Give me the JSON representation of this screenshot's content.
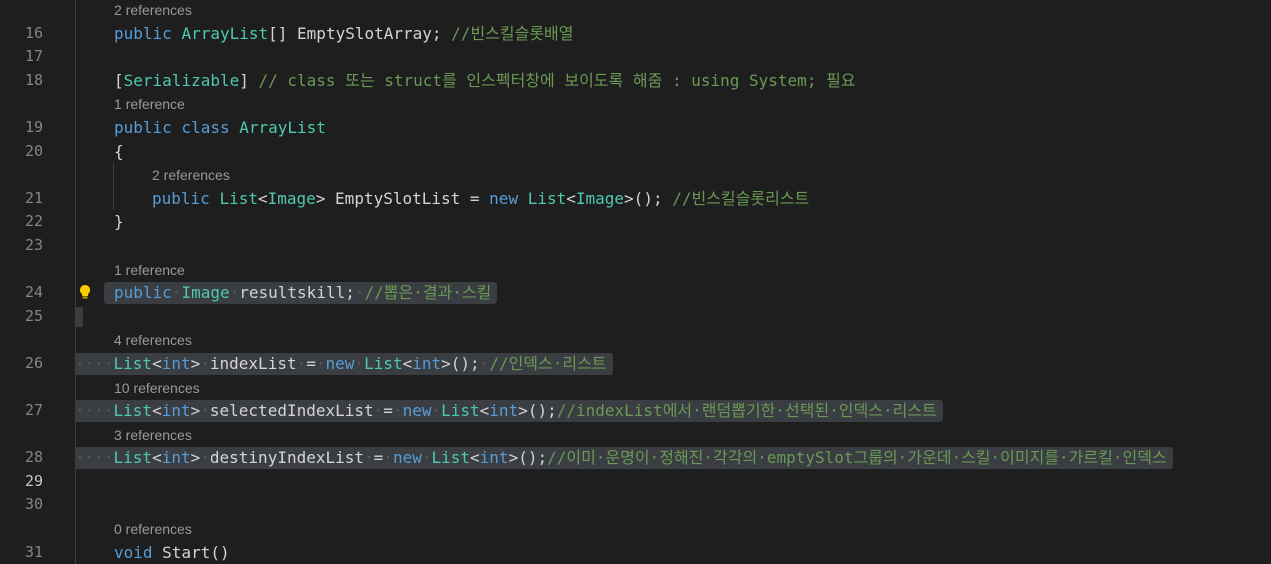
{
  "editor": {
    "lines": [
      {
        "kind": "lens",
        "text": "2 references"
      },
      {
        "kind": "code",
        "num": "16",
        "tokens": [
          {
            "c": "kw",
            "t": "public "
          },
          {
            "c": "ty",
            "t": "ArrayList"
          },
          {
            "c": "pl",
            "t": "[] EmptySlotArray; "
          },
          {
            "c": "cm",
            "t": "//빈스킬슬롯배열"
          }
        ]
      },
      {
        "kind": "code",
        "num": "17",
        "tokens": []
      },
      {
        "kind": "code",
        "num": "18",
        "tokens": [
          {
            "c": "pl",
            "t": "["
          },
          {
            "c": "ty",
            "t": "Serializable"
          },
          {
            "c": "pl",
            "t": "] "
          },
          {
            "c": "cm",
            "t": "// class 또는 struct를 인스펙터창에 보이도록 해줌 : using System; 필요"
          }
        ]
      },
      {
        "kind": "lens",
        "text": "1 reference"
      },
      {
        "kind": "code",
        "num": "19",
        "tokens": [
          {
            "c": "kw",
            "t": "public class "
          },
          {
            "c": "ty",
            "t": "ArrayList"
          }
        ]
      },
      {
        "kind": "code",
        "num": "20",
        "tokens": [
          {
            "c": "pl",
            "t": "{"
          }
        ]
      },
      {
        "kind": "lens",
        "text": "2 references",
        "indent": 2
      },
      {
        "kind": "code",
        "num": "21",
        "indent": 2,
        "tokens": [
          {
            "c": "kw",
            "t": "public "
          },
          {
            "c": "ty",
            "t": "List"
          },
          {
            "c": "pl",
            "t": "<"
          },
          {
            "c": "ty",
            "t": "Image"
          },
          {
            "c": "pl",
            "t": "> EmptySlotList = "
          },
          {
            "c": "kw",
            "t": "new "
          },
          {
            "c": "ty",
            "t": "List"
          },
          {
            "c": "pl",
            "t": "<"
          },
          {
            "c": "ty",
            "t": "Image"
          },
          {
            "c": "pl",
            "t": ">(); "
          },
          {
            "c": "cm",
            "t": "//빈스킬슬롯리스트"
          }
        ]
      },
      {
        "kind": "code",
        "num": "22",
        "tokens": [
          {
            "c": "pl",
            "t": "}"
          }
        ]
      },
      {
        "kind": "code",
        "num": "23",
        "tokens": []
      },
      {
        "kind": "lens",
        "text": "1 reference"
      },
      {
        "kind": "code",
        "num": "24",
        "selected": true,
        "bulb": true,
        "tokens": [
          {
            "c": "kw",
            "t": "public"
          },
          {
            "c": "ws",
            "t": "·"
          },
          {
            "c": "ty",
            "t": "Image"
          },
          {
            "c": "ws",
            "t": "·"
          },
          {
            "c": "pl",
            "t": "resultskill;"
          },
          {
            "c": "ws",
            "t": "·"
          },
          {
            "c": "cm",
            "t": "//뽑은·결과·스킬"
          }
        ]
      },
      {
        "kind": "code",
        "num": "25",
        "caret": true,
        "tokens": []
      },
      {
        "kind": "lens",
        "text": "4 references"
      },
      {
        "kind": "code",
        "num": "26",
        "selected": true,
        "tokens": [
          {
            "c": "ws",
            "t": "····"
          },
          {
            "c": "ty",
            "t": "List"
          },
          {
            "c": "pl",
            "t": "<"
          },
          {
            "c": "kw",
            "t": "int"
          },
          {
            "c": "pl",
            "t": ">"
          },
          {
            "c": "ws",
            "t": "·"
          },
          {
            "c": "pl",
            "t": "indexList"
          },
          {
            "c": "ws",
            "t": "·"
          },
          {
            "c": "pl",
            "t": "="
          },
          {
            "c": "ws",
            "t": "·"
          },
          {
            "c": "kw",
            "t": "new"
          },
          {
            "c": "ws",
            "t": "·"
          },
          {
            "c": "ty",
            "t": "List"
          },
          {
            "c": "pl",
            "t": "<"
          },
          {
            "c": "kw",
            "t": "int"
          },
          {
            "c": "pl",
            "t": ">();"
          },
          {
            "c": "ws",
            "t": "·"
          },
          {
            "c": "cm",
            "t": "//인덱스·리스트"
          }
        ]
      },
      {
        "kind": "lens",
        "text": "10 references"
      },
      {
        "kind": "code",
        "num": "27",
        "selected": true,
        "tokens": [
          {
            "c": "ws",
            "t": "····"
          },
          {
            "c": "ty",
            "t": "List"
          },
          {
            "c": "pl",
            "t": "<"
          },
          {
            "c": "kw",
            "t": "int"
          },
          {
            "c": "pl",
            "t": ">"
          },
          {
            "c": "ws",
            "t": "·"
          },
          {
            "c": "pl",
            "t": "selectedIndexList"
          },
          {
            "c": "ws",
            "t": "·"
          },
          {
            "c": "pl",
            "t": "="
          },
          {
            "c": "ws",
            "t": "·"
          },
          {
            "c": "kw",
            "t": "new"
          },
          {
            "c": "ws",
            "t": "·"
          },
          {
            "c": "ty",
            "t": "List"
          },
          {
            "c": "pl",
            "t": "<"
          },
          {
            "c": "kw",
            "t": "int"
          },
          {
            "c": "pl",
            "t": ">();"
          },
          {
            "c": "cm",
            "t": "//indexList에서·랜덤뽑기한·선택된·인덱스·리스트"
          }
        ]
      },
      {
        "kind": "lens",
        "text": "3 references"
      },
      {
        "kind": "code",
        "num": "28",
        "selected": true,
        "tokens": [
          {
            "c": "ws",
            "t": "····"
          },
          {
            "c": "ty",
            "t": "List"
          },
          {
            "c": "pl",
            "t": "<"
          },
          {
            "c": "kw",
            "t": "int"
          },
          {
            "c": "pl",
            "t": ">"
          },
          {
            "c": "ws",
            "t": "·"
          },
          {
            "c": "pl",
            "t": "destinyIndexList"
          },
          {
            "c": "ws",
            "t": "·"
          },
          {
            "c": "pl",
            "t": "="
          },
          {
            "c": "ws",
            "t": "·"
          },
          {
            "c": "kw",
            "t": "new"
          },
          {
            "c": "ws",
            "t": "·"
          },
          {
            "c": "ty",
            "t": "List"
          },
          {
            "c": "pl",
            "t": "<"
          },
          {
            "c": "kw",
            "t": "int"
          },
          {
            "c": "pl",
            "t": ">();"
          },
          {
            "c": "cm",
            "t": "//이미·운명이·정해진·각각의·emptySlot그룹의·가운데·스킬·이미지를·가르킬·인덱스"
          }
        ]
      },
      {
        "kind": "code",
        "num": "29",
        "active": true,
        "tokens": []
      },
      {
        "kind": "code",
        "num": "30",
        "tokens": []
      },
      {
        "kind": "lens",
        "text": "0 references"
      },
      {
        "kind": "code",
        "num": "31",
        "tokens": [
          {
            "c": "kw",
            "t": "void "
          },
          {
            "c": "pl",
            "t": "Start()"
          }
        ]
      }
    ]
  },
  "colors": {
    "background": "#1e1e1e",
    "keyword": "#569cd6",
    "type": "#4ec9b0",
    "comment": "#6a9955",
    "selection": "#3a3d41",
    "lightbulb": "#ffcc00"
  },
  "icons": {
    "gutter_hint": "lightbulb-icon"
  }
}
